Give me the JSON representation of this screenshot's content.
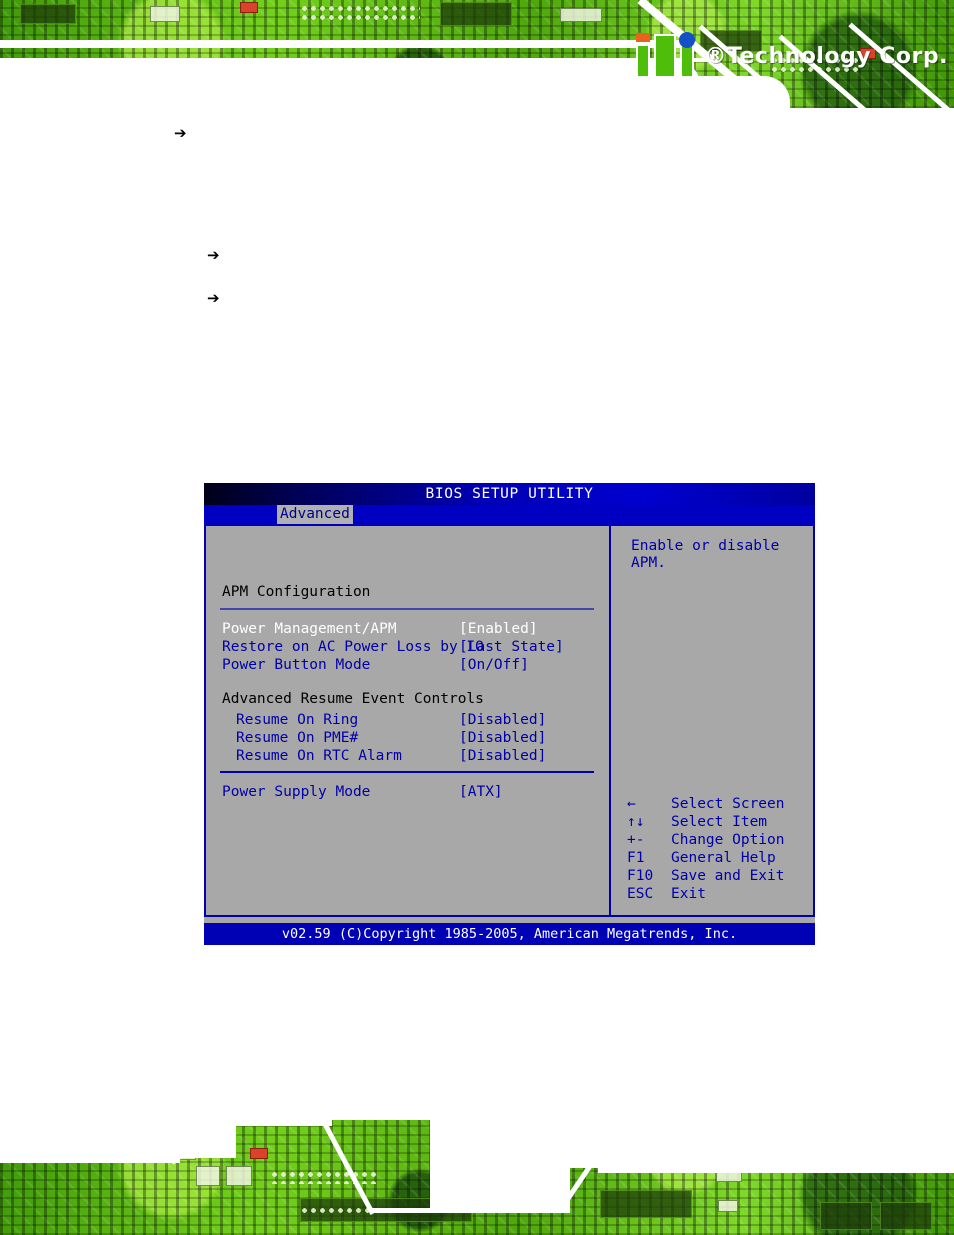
{
  "page": {
    "background_color": "#ffffff",
    "accent_green": "#5fc512",
    "bios_blue": "#0000b0"
  },
  "header": {
    "logo_mark_name": "iei-logo",
    "logo_text": "®Technology Corp.",
    "registered_symbol": "®",
    "brand_suffix": "Technology Corp."
  },
  "body_bullets": [
    {
      "icon": "arrow-right-icon",
      "glyph": "➔",
      "text": ""
    },
    {
      "icon": "arrow-right-icon",
      "glyph": "➔",
      "text": ""
    },
    {
      "icon": "arrow-right-icon",
      "glyph": "➔",
      "text": ""
    }
  ],
  "bios": {
    "title": "BIOS SETUP UTILITY",
    "tabs": [
      {
        "label": "Advanced",
        "selected": true
      }
    ],
    "section_title": "APM Configuration",
    "group_title": "Advanced Resume Event Controls",
    "options": [
      {
        "label": "Power Management/APM",
        "value": "[Enabled]",
        "selected": true
      },
      {
        "label": "Restore on AC Power Loss by IO",
        "value": "[Last State]",
        "selected": false
      },
      {
        "label": "Power Button Mode",
        "value": "[On/Off]",
        "selected": false
      }
    ],
    "resume_options": [
      {
        "label": "Resume On Ring",
        "value": "[Disabled]",
        "selected": false
      },
      {
        "label": "Resume On PME#",
        "value": "[Disabled]",
        "selected": false
      },
      {
        "label": "Resume On RTC Alarm",
        "value": "[Disabled]",
        "selected": false
      }
    ],
    "power_supply": {
      "label": "Power Supply Mode",
      "value": "[ATX]",
      "selected": false
    },
    "help": {
      "line1": "Enable or disable",
      "line2": "APM."
    },
    "legend": [
      {
        "key": "←",
        "desc": "Select Screen"
      },
      {
        "key": "↑↓",
        "desc": "Select Item"
      },
      {
        "key": "+-",
        "desc": "Change Option"
      },
      {
        "key": "F1",
        "desc": "General Help"
      },
      {
        "key": "F10",
        "desc": "Save and Exit"
      },
      {
        "key": "ESC",
        "desc": "Exit"
      }
    ],
    "footer": "v02.59 (C)Copyright 1985-2005, American Megatrends, Inc."
  }
}
